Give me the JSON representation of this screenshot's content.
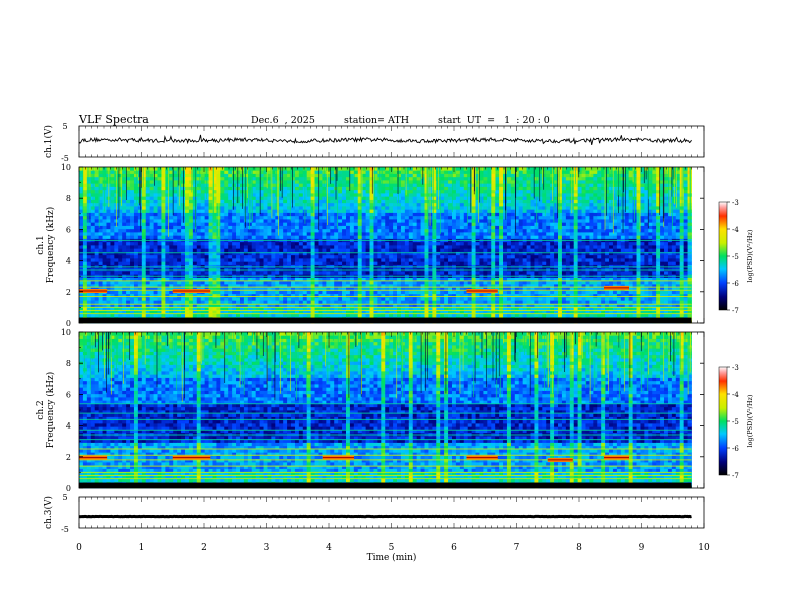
{
  "header": {
    "title": "VLF Spectra",
    "date": "Dec.6  , 2025",
    "station": "station= ATH",
    "start": "start  UT  =   1  : 20 : 0"
  },
  "chart_data": [
    {
      "type": "line",
      "name": "ch1-waveform",
      "ylabel": "ch.1(V)",
      "ylim": [
        -5,
        5
      ],
      "yticks": [
        "5",
        "-5"
      ],
      "xlim": [
        0,
        10
      ],
      "baseline": 0.4,
      "noise": 0.6
    },
    {
      "type": "heatmap",
      "name": "ch1-spectrogram",
      "ylabel": [
        "ch.1",
        "Frequency  (kHz)"
      ],
      "ylim": [
        0,
        10
      ],
      "yticks": [
        "0",
        "2",
        "4",
        "6",
        "8",
        "10"
      ],
      "xlim": [
        0,
        9.8
      ],
      "colorbar": {
        "label": "log(PSD)(V²/Hz)",
        "range": [
          -7,
          -3
        ],
        "ticks": [
          "-3",
          "-4",
          "-5",
          "-6",
          "-7"
        ]
      },
      "lines_khz": [
        0.3,
        0.6,
        0.8,
        1.0,
        1.2,
        1.7,
        2.1,
        2.3,
        2.7,
        3.0,
        3.4,
        3.6,
        4.5,
        5.3
      ],
      "segments": [
        {
          "t0": 0.0,
          "t1": 0.45,
          "f": 2.05
        },
        {
          "t0": 1.5,
          "t1": 2.1,
          "f": 2.05
        },
        {
          "t0": 6.2,
          "t1": 6.7,
          "f": 2.05
        },
        {
          "t0": 8.4,
          "t1": 8.8,
          "f": 2.25
        }
      ]
    },
    {
      "type": "heatmap",
      "name": "ch2-spectrogram",
      "ylabel": [
        "ch.2",
        "Frequency  (kHz)"
      ],
      "ylim": [
        0,
        10
      ],
      "yticks": [
        "0",
        "2",
        "4",
        "6",
        "8",
        "10"
      ],
      "xlim": [
        0,
        9.8
      ],
      "colorbar": {
        "label": "log(PSD)(V²/Hz)",
        "range": [
          -7,
          -3
        ],
        "ticks": [
          "-3",
          "-4",
          "-5",
          "-6",
          "-7"
        ]
      },
      "lines_khz": [
        0.6,
        0.8,
        1.0,
        1.4,
        1.8,
        2.1,
        2.5,
        3.1,
        3.4,
        3.7,
        4.4,
        4.8,
        5.4
      ],
      "segments": [
        {
          "t0": 0.0,
          "t1": 0.45,
          "f": 1.95
        },
        {
          "t0": 1.5,
          "t1": 2.1,
          "f": 1.95
        },
        {
          "t0": 3.9,
          "t1": 4.4,
          "f": 1.95
        },
        {
          "t0": 6.2,
          "t1": 6.7,
          "f": 1.95
        },
        {
          "t0": 7.5,
          "t1": 7.9,
          "f": 1.8
        },
        {
          "t0": 8.4,
          "t1": 8.8,
          "f": 1.95
        }
      ]
    },
    {
      "type": "line",
      "name": "ch3-waveform",
      "ylabel": "ch.3(V)",
      "ylim": [
        -5,
        5
      ],
      "yticks": [
        "5",
        "-5"
      ],
      "xlim": [
        0,
        10
      ],
      "baseline": -1.3,
      "noise": 0.05
    }
  ],
  "xaxis": {
    "label": "Time  (min)",
    "ticks": [
      "0",
      "1",
      "2",
      "3",
      "4",
      "5",
      "6",
      "7",
      "8",
      "9",
      "10"
    ]
  }
}
